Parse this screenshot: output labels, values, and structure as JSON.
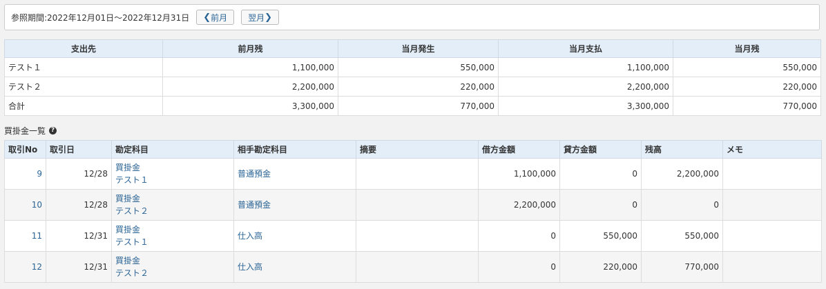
{
  "period": {
    "label": "参照期間:2022年12月01日～2022年12月31日",
    "prev_chev": "❮",
    "prev_label": "前月",
    "next_label": "翌月",
    "next_chev": "❯"
  },
  "summary": {
    "headers": [
      "支出先",
      "前月残",
      "当月発生",
      "当月支払",
      "当月残"
    ],
    "rows": [
      [
        "テスト１",
        "1,100,000",
        "550,000",
        "1,100,000",
        "550,000"
      ],
      [
        "テスト２",
        "2,200,000",
        "220,000",
        "2,200,000",
        "220,000"
      ],
      [
        "合計",
        "3,300,000",
        "770,000",
        "3,300,000",
        "770,000"
      ]
    ]
  },
  "section": {
    "title": "買掛金一覧",
    "help": "?"
  },
  "list": {
    "headers": [
      "取引No",
      "取引日",
      "勘定科目",
      "相手勘定科目",
      "摘要",
      "借方金額",
      "貸方金額",
      "残高",
      "メモ"
    ],
    "rows": [
      {
        "no": "9",
        "date": "12/28",
        "account": "買掛金",
        "sub": "テスト１",
        "counter": "普通預金",
        "memo_desc": "",
        "debit": "1,100,000",
        "credit": "0",
        "balance": "2,200,000",
        "memo": ""
      },
      {
        "no": "10",
        "date": "12/28",
        "account": "買掛金",
        "sub": "テスト２",
        "counter": "普通預金",
        "memo_desc": "",
        "debit": "2,200,000",
        "credit": "0",
        "balance": "0",
        "memo": ""
      },
      {
        "no": "11",
        "date": "12/31",
        "account": "買掛金",
        "sub": "テスト１",
        "counter": "仕入高",
        "memo_desc": "",
        "debit": "0",
        "credit": "550,000",
        "balance": "550,000",
        "memo": ""
      },
      {
        "no": "12",
        "date": "12/31",
        "account": "買掛金",
        "sub": "テスト２",
        "counter": "仕入高",
        "memo_desc": "",
        "debit": "0",
        "credit": "220,000",
        "balance": "770,000",
        "memo": ""
      }
    ]
  }
}
